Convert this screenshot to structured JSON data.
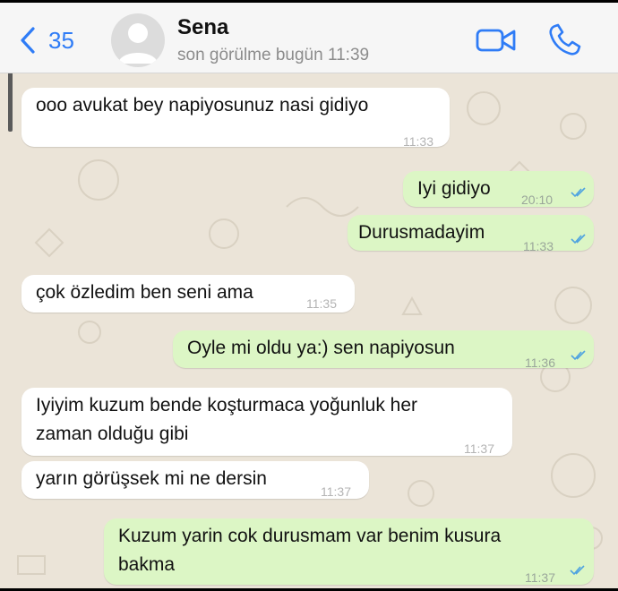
{
  "header": {
    "back_count": "35",
    "contact_name": "Sena",
    "last_seen": "son görülme bugün 11:39",
    "icons": [
      "back-chevron-icon",
      "avatar-placeholder-icon",
      "video-call-icon",
      "voice-call-icon"
    ]
  },
  "colors": {
    "accent": "#2f7cf6",
    "incoming_bubble": "#ffffff",
    "outgoing_bubble": "#dcf6c5",
    "chat_background": "#ebe4d8",
    "read_tick": "#4fa3e0"
  },
  "messages": [
    {
      "direction": "in",
      "text": "ooo avukat bey napiyosunuz nasi gidiyo",
      "time": "11:33"
    },
    {
      "direction": "out",
      "text": "Iyi gidiyo",
      "time": "20:10",
      "read": true
    },
    {
      "direction": "out",
      "text": "Durusmadayim",
      "time": "11:33",
      "read": true
    },
    {
      "direction": "in",
      "text": "çok özledim ben seni ama",
      "time": "11:35"
    },
    {
      "direction": "out",
      "text": "Oyle mi oldu ya:) sen napiyosun",
      "time": "11:36",
      "read": true
    },
    {
      "direction": "in",
      "lines": [
        "Iyiyim kuzum bende koşturmaca yoğunluk her",
        "zaman olduğu gibi"
      ],
      "time": "11:37"
    },
    {
      "direction": "in",
      "text": "yarın görüşsek mi ne dersin",
      "time": "11:37"
    },
    {
      "direction": "out",
      "lines": [
        "Kuzum yarin cok durusmam var benim kusura",
        "bakma"
      ],
      "time": "11:37",
      "read": true
    }
  ]
}
